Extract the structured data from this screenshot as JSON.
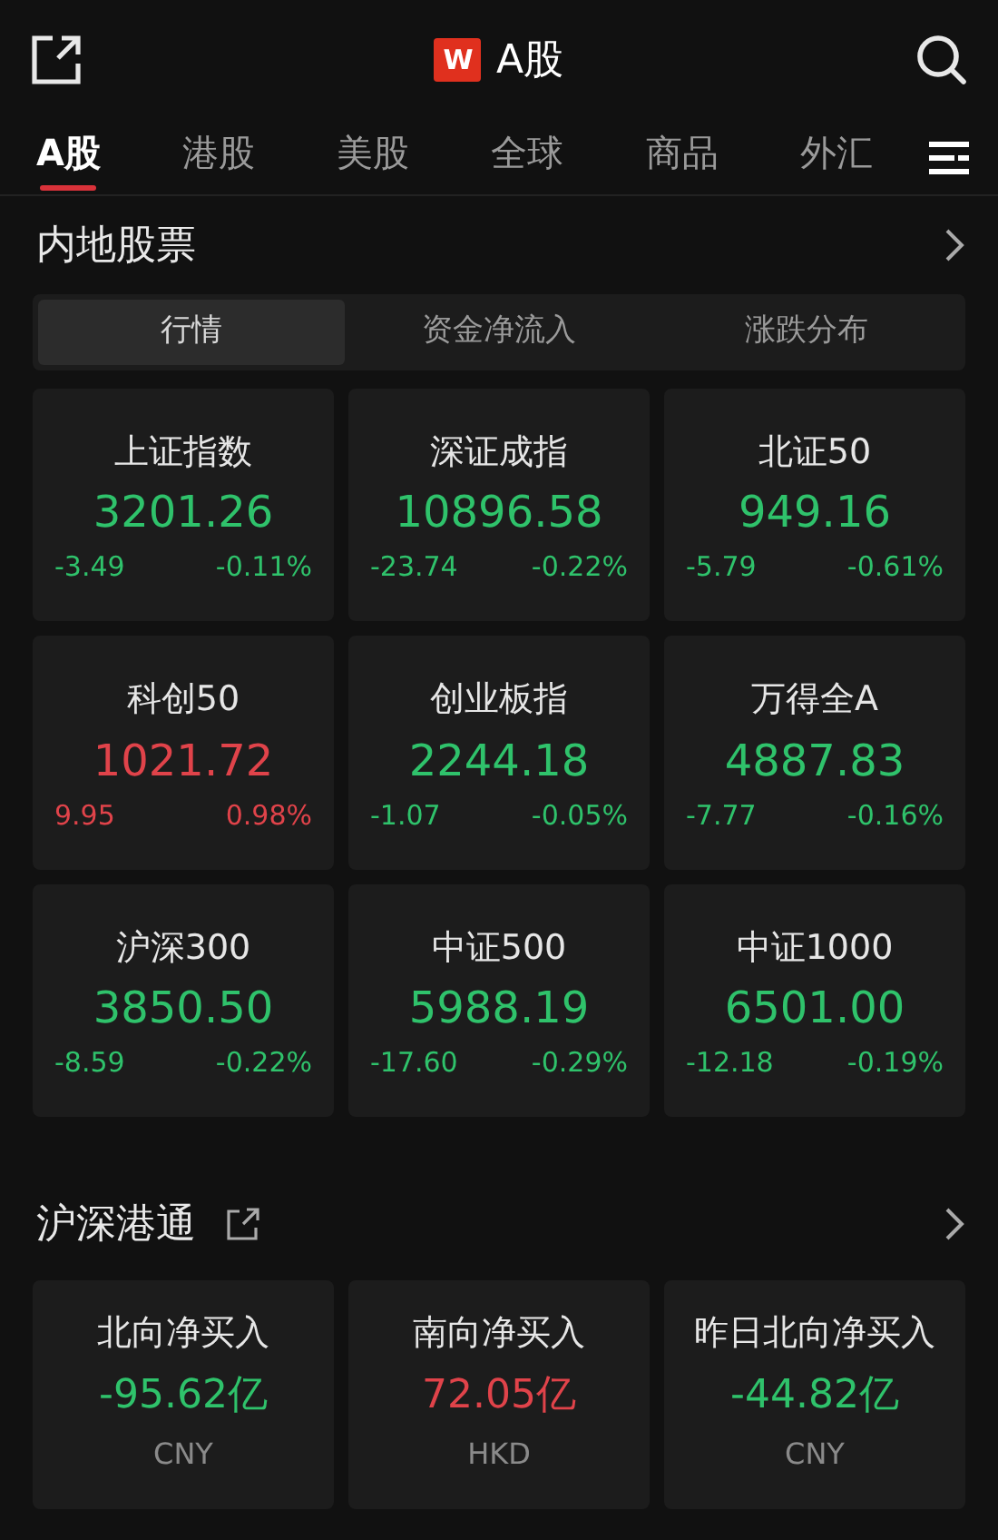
{
  "header": {
    "logo": "W",
    "title": "A股"
  },
  "market_tabs": [
    {
      "label": "A股",
      "selected": true
    },
    {
      "label": "港股",
      "selected": false
    },
    {
      "label": "美股",
      "selected": false
    },
    {
      "label": "全球",
      "selected": false
    },
    {
      "label": "商品",
      "selected": false
    },
    {
      "label": "外汇",
      "selected": false
    }
  ],
  "mainland": {
    "title": "内地股票",
    "segments": [
      {
        "label": "行情",
        "selected": true
      },
      {
        "label": "资金净流入",
        "selected": false
      },
      {
        "label": "涨跌分布",
        "selected": false
      }
    ],
    "indices": [
      {
        "name": "上证指数",
        "price": "3201.26",
        "change": "-3.49",
        "percent": "-0.11%",
        "color": "#2fc26b"
      },
      {
        "name": "深证成指",
        "price": "10896.58",
        "change": "-23.74",
        "percent": "-0.22%",
        "color": "#2fc26b"
      },
      {
        "name": "北证50",
        "price": "949.16",
        "change": "-5.79",
        "percent": "-0.61%",
        "color": "#2fc26b"
      },
      {
        "name": "科创50",
        "price": "1021.72",
        "change": "9.95",
        "percent": "0.98%",
        "color": "#e0434a"
      },
      {
        "name": "创业板指",
        "price": "2244.18",
        "change": "-1.07",
        "percent": "-0.05%",
        "color": "#2fc26b"
      },
      {
        "name": "万得全A",
        "price": "4887.83",
        "change": "-7.77",
        "percent": "-0.16%",
        "color": "#2fc26b"
      },
      {
        "name": "沪深300",
        "price": "3850.50",
        "change": "-8.59",
        "percent": "-0.22%",
        "color": "#2fc26b"
      },
      {
        "name": "中证500",
        "price": "5988.19",
        "change": "-17.60",
        "percent": "-0.29%",
        "color": "#2fc26b"
      },
      {
        "name": "中证1000",
        "price": "6501.00",
        "change": "-12.18",
        "percent": "-0.19%",
        "color": "#2fc26b"
      }
    ]
  },
  "connect": {
    "title": "沪深港通",
    "flows": [
      {
        "name": "北向净买入",
        "amount": "-95.62亿",
        "currency": "CNY",
        "color": "#2fc26b"
      },
      {
        "name": "南向净买入",
        "amount": "72.05亿",
        "currency": "HKD",
        "color": "#e0434a"
      },
      {
        "name": "昨日北向净买入",
        "amount": "-44.82亿",
        "currency": "CNY",
        "color": "#2fc26b"
      }
    ]
  }
}
